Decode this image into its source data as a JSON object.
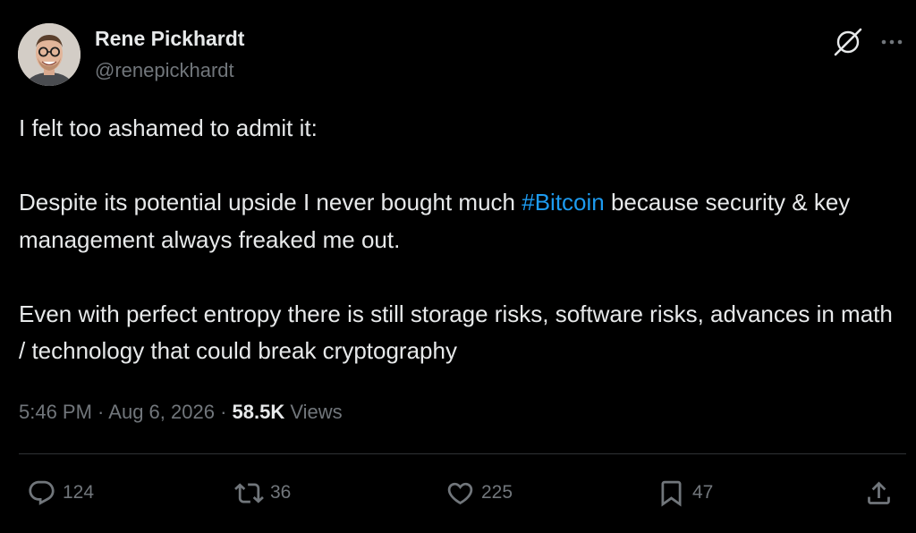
{
  "author": {
    "display_name": "Rene Pickhardt",
    "handle": "@renepickhardt"
  },
  "post": {
    "line1": "I felt too ashamed to admit it:",
    "para2_before": "Despite its potential upside I never bought much ",
    "hashtag": "#Bitcoin",
    "para2_after": " because security & key management always freaked me out.",
    "para3": "Even with perfect entropy there is still storage risks, software risks, advances in math / technology that could break cryptography"
  },
  "meta": {
    "time": "5:46 PM",
    "sep1": " · ",
    "date": "Aug 6, 2026",
    "sep2": " · ",
    "views_count": "58.5K",
    "views_label": " Views"
  },
  "actions": {
    "reply_count": "124",
    "repost_count": "36",
    "like_count": "225",
    "bookmark_count": "47"
  },
  "icons": {
    "top_right": [
      "grok-icon",
      "more-icon"
    ],
    "actions": [
      "reply-icon",
      "repost-icon",
      "like-icon",
      "bookmark-icon",
      "share-icon"
    ]
  },
  "colors": {
    "background": "#000000",
    "text": "#e7e9ea",
    "secondary": "#71767b",
    "link": "#1d9bf0",
    "divider": "#2f3336"
  }
}
